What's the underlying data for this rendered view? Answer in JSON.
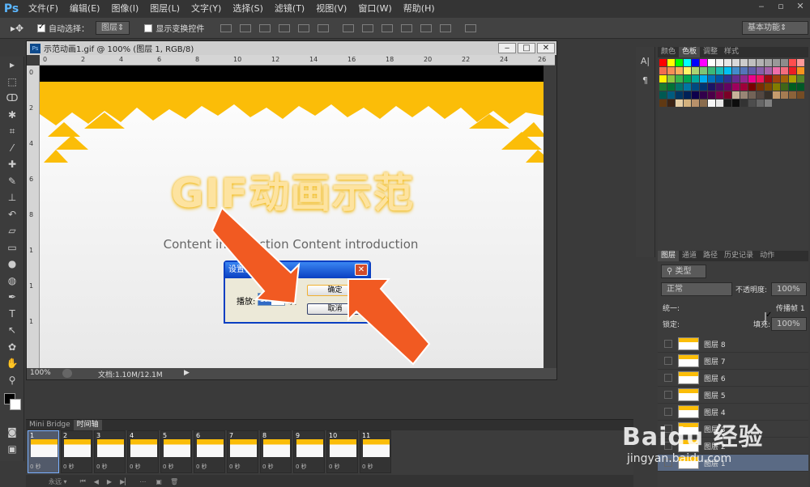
{
  "app": {
    "logo": "Ps",
    "menu": [
      "文件(F)",
      "编辑(E)",
      "图像(I)",
      "图层(L)",
      "文字(Y)",
      "选择(S)",
      "滤镜(T)",
      "视图(V)",
      "窗口(W)",
      "帮助(H)"
    ]
  },
  "options": {
    "auto_select_label": "自动选择：",
    "auto_select_value": "图层",
    "show_transform_label": "显示变换控件",
    "workspace": "基本功能"
  },
  "document": {
    "title": "示范动画1.gif @ 100% (图层 1, RGB/8)",
    "zoom": "100%",
    "doc_info": "文档:1.10M/12.1M",
    "ruler_h": [
      "0",
      "2",
      "4",
      "6",
      "8",
      "10",
      "12",
      "14",
      "16",
      "18",
      "20",
      "22",
      "24",
      "26"
    ],
    "ruler_v": [
      "0",
      "2",
      "4",
      "6",
      "8",
      "1",
      "1",
      "1"
    ],
    "canvas_heading": "GIF动画示范",
    "canvas_sub": "Content introduction Content introduction"
  },
  "dialog": {
    "title": "设置循环次数",
    "play_label": "播放:",
    "play_value": "10",
    "unit": "次",
    "ok": "确定",
    "cancel": "取消"
  },
  "swatches_panel": {
    "tabs": [
      "颜色",
      "色板",
      "调整",
      "样式"
    ],
    "active": 1,
    "colors": [
      "#ff0000",
      "#ffff00",
      "#00ff00",
      "#00ffff",
      "#0000ff",
      "#ff00ff",
      "#ffffff",
      "#f2f2f2",
      "#e6e6e6",
      "#d9d9d9",
      "#cccccc",
      "#bfbfbf",
      "#b3b3b3",
      "#a6a6a6",
      "#999999",
      "#8c8c8c",
      "#ff4d4d",
      "#ff9999",
      "#f26c4f",
      "#f68e55",
      "#fbaf5c",
      "#fff467",
      "#acd372",
      "#7cc576",
      "#3bb878",
      "#1abbb4",
      "#00bff3",
      "#438ccb",
      "#5574b9",
      "#605ca8",
      "#855fa8",
      "#a763a9",
      "#f06eaa",
      "#f26d7d",
      "#ed1c24",
      "#f7941d",
      "#fff200",
      "#8dc63f",
      "#39b54a",
      "#00a651",
      "#00a99d",
      "#00aeef",
      "#0072bc",
      "#0054a6",
      "#2e3192",
      "#662d91",
      "#92278f",
      "#ec008c",
      "#ed145b",
      "#9e0b0f",
      "#a0410d",
      "#a36209",
      "#aba000",
      "#598527",
      "#1a7b30",
      "#007236",
      "#00746b",
      "#0076a3",
      "#004a80",
      "#003471",
      "#1b1464",
      "#440e62",
      "#630460",
      "#9e005d",
      "#9e0039",
      "#790000",
      "#7b2e00",
      "#7d4900",
      "#827b00",
      "#406618",
      "#005e20",
      "#005826",
      "#005952",
      "#005b7f",
      "#003663",
      "#002157",
      "#0d004c",
      "#32004b",
      "#4b0049",
      "#7b0046",
      "#7a0026",
      "#c7b299",
      "#998675",
      "#736357",
      "#534741",
      "#37302a",
      "#c69c6d",
      "#a67c52",
      "#8c6239",
      "#754c24",
      "#603913",
      "#3c2415",
      "#e6cfa6",
      "#d4b27e",
      "#b8916b",
      "#8a6c4d",
      "#f5f5f5",
      "#e8e8e8",
      "#1a1a1a",
      "#0d0d0d",
      "#333333",
      "#4d4d4d",
      "#666666",
      "#808080"
    ]
  },
  "layers_panel": {
    "tabs": [
      "图层",
      "通道",
      "路径",
      "历史记录",
      "动作"
    ],
    "filter": "类型",
    "blend_mode": "正常",
    "opacity_label": "不透明度:",
    "opacity": "100%",
    "unify_label": "统一:",
    "propagate_label": "传播帧 1",
    "lock_label": "锁定:",
    "fill_label": "填充:",
    "fill": "100%",
    "layers": [
      "图层 8",
      "图层 7",
      "图层 6",
      "图层 5",
      "图层 4",
      "图层 3",
      "图层 2",
      "图层 1"
    ]
  },
  "timeline": {
    "tabs": [
      "Mini Bridge",
      "时间轴"
    ],
    "frames": [
      "1",
      "2",
      "3",
      "4",
      "5",
      "6",
      "7",
      "8",
      "9",
      "10",
      "11"
    ],
    "delay": "0 秒",
    "loop": "永远"
  },
  "watermark": {
    "brand": "Baidu 经验",
    "url": "jingyan.baidu.com"
  }
}
